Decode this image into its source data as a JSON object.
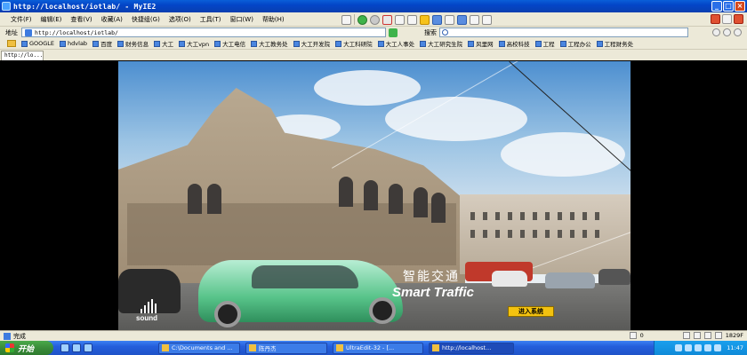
{
  "window": {
    "title": "http://localhost/iotlab/ - MyIE2"
  },
  "menubar": {
    "items": [
      "文件(F)",
      "编辑(E)",
      "查看(V)",
      "收藏(A)",
      "快捷组(G)",
      "选项(O)",
      "工具(T)",
      "窗口(W)",
      "帮助(H)"
    ]
  },
  "address": {
    "label": "地址",
    "url": "http://localhost/iotlab/"
  },
  "search": {
    "label": "搜索",
    "value": ""
  },
  "favorites": {
    "items": [
      "GOOGLE",
      "hdvlab",
      "百度",
      "财务信息",
      "大工",
      "大工vpn",
      "大工电信",
      "大工教务处",
      "大工开发院",
      "大工科研院",
      "大工人事处",
      "大工研究生院",
      "风里网",
      "高校科技",
      "工程",
      "工程办公",
      "工程财务处"
    ]
  },
  "tabs": [
    {
      "label": "http://lo..."
    }
  ],
  "page": {
    "title_cn": "智能交通",
    "title_en": "Smart Traffic",
    "enter_button": "进入系统",
    "sound_label": "sound"
  },
  "statusbar": {
    "text": "完成",
    "count": "0",
    "size": "1829F"
  },
  "taskbar": {
    "start_label": "开始",
    "tasks": [
      "C:\\Documents and ...",
      "陈丹杰",
      "UltraEdit-32 - [...",
      "http://localhost..."
    ],
    "active_task": 3,
    "clock": "11:47"
  },
  "colors": {
    "title_bar": "#0345c7",
    "enter_button": "#f3c20f",
    "taskbar": "#245edb",
    "start_button": "#3a8c3a"
  }
}
